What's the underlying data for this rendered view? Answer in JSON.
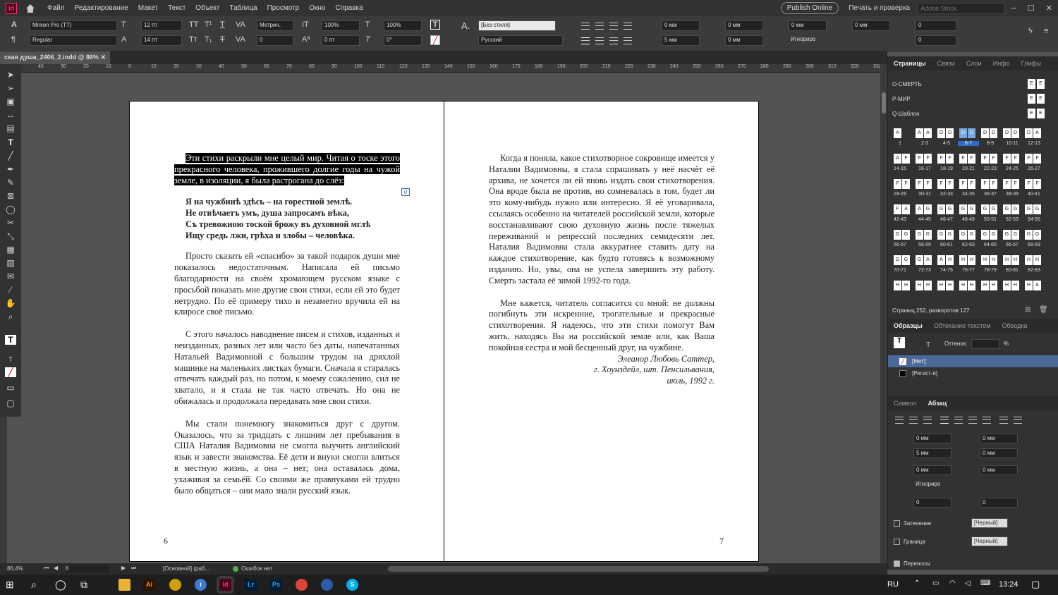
{
  "menubar": {
    "logo": "Id",
    "items": [
      "Файл",
      "Редактирование",
      "Макет",
      "Текст",
      "Объект",
      "Таблица",
      "Просмотр",
      "Окно",
      "Справка"
    ],
    "publish": "Publish Online",
    "workspace": "Печать и проверка",
    "search_placeholder": "Adobe Stock"
  },
  "control": {
    "font": "Minion Pro (TT)",
    "style": "Regular",
    "size": "12 пт",
    "leading": "14 пт",
    "kerning": "Метрич.",
    "tracking": "0",
    "vscale": "100%",
    "hscale": "100%",
    "baseline": "0 пт",
    "skew": "0°",
    "para_style": "[Без стиля]",
    "language": "Русский",
    "indent_left": "0 мм",
    "indent_right": "0 мм",
    "indent_first": "5 мм",
    "indent_last": "0 мм",
    "space_before": "0 мм",
    "space_after": "0 мм",
    "grid": "Игнориро",
    "dropcap_lines": "0",
    "dropcap_chars": "0"
  },
  "doc_tab": {
    "title": "ская душа_2406_2.indd @ 86%"
  },
  "ruler": [
    "40",
    "30",
    "20",
    "10",
    "0",
    "10",
    "20",
    "30",
    "40",
    "50",
    "60",
    "70",
    "80",
    "90",
    "100",
    "110",
    "120",
    "130",
    "140",
    "150",
    "160",
    "170",
    "180",
    "190",
    "200",
    "210",
    "220",
    "230",
    "240",
    "250",
    "260",
    "270",
    "280",
    "290",
    "300",
    "310",
    "320",
    "33("
  ],
  "left_page": {
    "intro_selected": "Эти стихи раскрыли мне целый мир. Читая о тоске этого прекрасного человека, прожившего долгие годы на чужой земле, в изоляции, я была растрогана до слёз:",
    "poem": [
      "Я на чужбинѣ здѣсь – на горестной землѣ.",
      "Не отвѣчаетъ умъ, душа запросамъ вѣка,",
      "Съ тревожною тоской брожу въ духовной мглѣ",
      "Ищу средь лжи, грѣха и злобы – человѣка."
    ],
    "para2": "Просто сказать ей «спасибо» за такой подарок души мне показалось недостаточным. Написала ей письмо благодарности на своём хромающем русском языке с просьбой показать мне другие свои стихи, если ей это будет нетрудно. По её примеру тихо и незаметно вручила ей на клиросе своё письмо.",
    "para3": "С этого началось наводнение писем и стихов, изданных и неизданных, разных лет или часто без даты, напечатанных Натальей Вадимовной с большим трудом на дряхлой машинке на маленьких листках бумаги. Сначала я старалась отвечать каждый раз, но потом, к моему сожалению, сил не хватало, и я стала не так часто отвечать. Но она не обижалась и продолжала передавать мне свои стихи.",
    "para4": "Мы стали понемногу знакомиться друг с другом. Оказалось, что за тридцать с лишним лет пребывания в США Наталия Вадимовна не смогла выучить английский язык и завести знакомства. Её дети и внуки смогли влиться в местную жизнь, а она – нет; она оставалась дома, ухаживая за семьёй. Со своими же правнуками ей трудно было общаться – они мало знали русский язык.",
    "page_number": "6"
  },
  "right_page": {
    "para1": "Когда я поняла, какое стихотворное сокровище имеется у Наталии Вадимовны, я стала спрашивать у неё насчёт её архива, не хочется ли ей вновь издать свои стихотворения. Она вроде была не против, но сомневалась в том, будет ли это кому-нибудь нужно или интересно. Я её уговаривала, ссылаясь особенно на читателей российской земли, которые восстанавливают свою духовную жизнь после тяжелых переживаний и репрессий последних семидесяти лет. Наталия Вадимовна стала аккуратнее ставить дату на каждое стихотворение, как будто готовясь к возможному изданию. Но, увы, она не успела завершить эту работу. Смерть застала её зимой 1992-го года.",
    "para2": "Мне кажется, читатель согласится со мной: не должны погибнуть эти искренние, трогательные и прекрасные стихотворения. Я надеюсь, что эти стихи помогут Вам жить, находясь Вы на российской земле или, как Ваша покойная сестра и мой бесценный друг, на чужбине.",
    "sig1": "Элеанор Любовь Саттер,",
    "sig2": "г. Хоунздейл, шт. Пенсильвания,",
    "sig3": "июль, 1992 г.",
    "page_number": "7"
  },
  "pages_panel": {
    "tabs": [
      "Страницы",
      "Связи",
      "Слои",
      "Инфо",
      "Глифы"
    ],
    "masters": [
      "О-СМЕРТЬ",
      "Р-МИР",
      "Q-Шаблон"
    ],
    "master_letters": [
      "E",
      "E",
      "E"
    ],
    "rows": [
      {
        "letters": [
          "A",
          "A A",
          "D D",
          "D D",
          "D D",
          "D D",
          "D A"
        ],
        "labels": [
          "1",
          "2-3",
          "4-5",
          "6-7",
          "8-9",
          "10-11",
          "12-13"
        ]
      },
      {
        "letters": [
          "A F",
          "F F",
          "F F",
          "F F",
          "F F",
          "F F",
          "F F"
        ],
        "labels": [
          "14-15",
          "16-17",
          "18-19",
          "20-21",
          "22-23",
          "24-25",
          "26-27"
        ]
      },
      {
        "letters": [
          "F F",
          "F F",
          "F F",
          "F F",
          "F F",
          "F F",
          "F F"
        ],
        "labels": [
          "28-29",
          "30-31",
          "32-33",
          "34-35",
          "36-37",
          "38-39",
          "40-41"
        ]
      },
      {
        "letters": [
          "F A",
          "A G",
          "G G",
          "G G",
          "G G",
          "G G",
          "G G"
        ],
        "labels": [
          "42-43",
          "44-45",
          "46-47",
          "48-49",
          "50-51",
          "52-53",
          "54-55"
        ]
      },
      {
        "letters": [
          "G G",
          "G G",
          "G G",
          "G G",
          "G G",
          "G G",
          "G G"
        ],
        "labels": [
          "56-57",
          "58-59",
          "60-61",
          "62-63",
          "64-65",
          "66-67",
          "68-69"
        ]
      },
      {
        "letters": [
          "G G",
          "G A",
          "A H",
          "H H",
          "H H",
          "H H",
          "H H"
        ],
        "labels": [
          "70-71",
          "72-73",
          "74-75",
          "76-77",
          "78-79",
          "80-81",
          "82-83"
        ]
      },
      {
        "letters": [
          "H H",
          "H H",
          "H H",
          "H H",
          "H H",
          "H H",
          "H A"
        ],
        "labels": []
      }
    ],
    "summary": "Страниц 252, разворотов 127"
  },
  "swatches_panel": {
    "tabs": [
      "Образцы",
      "Обтекание текстом",
      "Обводка"
    ],
    "tint_label": "Оттенок:",
    "percent": "%",
    "items": [
      "[Нет]",
      "[Регист-я]"
    ]
  },
  "para_panel": {
    "tabs": [
      "Символ",
      "Абзац"
    ],
    "indent_left": "0 мм",
    "indent_right": "0 мм",
    "indent_first": "5 мм",
    "indent_last": "0 мм",
    "space_before": "0 мм",
    "space_after": "0 мм",
    "grid": "Игнориро",
    "dropcap_lines": "0",
    "dropcap_chars": "0",
    "shading_label": "Затенение",
    "shading_color": "[Черный]",
    "border_label": "Граница",
    "border_color": "[Черный]",
    "hyphen_label": "Переносы"
  },
  "status": {
    "zoom": "86,4%",
    "page": "6",
    "profile": "[Основной] (раб...",
    "errors": "Ошибок нет"
  },
  "taskbar": {
    "lang": "RU",
    "time": "13:24",
    "apps": [
      "Ai",
      "Id",
      "Lr",
      "Ps"
    ]
  },
  "colors": {
    "accent": "#2d6bc4",
    "indesign": "#ff3366",
    "ok": "#4caf50"
  }
}
